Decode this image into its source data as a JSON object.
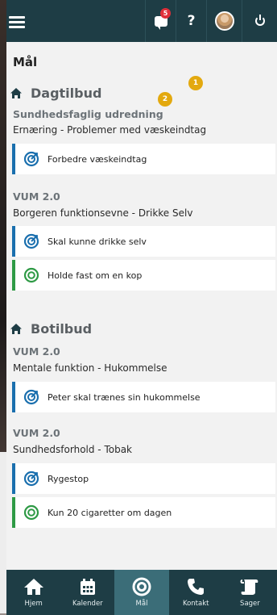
{
  "header": {
    "notification_count": "5",
    "help_label": "?"
  },
  "page": {
    "title": "Mål"
  },
  "markers": [
    "1",
    "2"
  ],
  "sections": [
    {
      "name": "Dagtilbud",
      "groups": [
        {
          "title": "Sundhedsfaglig udredning",
          "subtitle": "Ernæring - Problemer med væskeindtag",
          "goals": [
            {
              "label": "Forbedre væskeindtag",
              "type": "blue"
            }
          ]
        },
        {
          "title": "VUM 2.0",
          "subtitle": "Borgeren funktionsevne - Drikke Selv",
          "goals": [
            {
              "label": "Skal kunne drikke selv",
              "type": "blue"
            },
            {
              "label": "Holde fast om en kop",
              "type": "green"
            }
          ]
        }
      ]
    },
    {
      "name": "Botilbud",
      "groups": [
        {
          "title": "VUM 2.0",
          "subtitle": "Mentale funktion - Hukommelse",
          "goals": [
            {
              "label": "Peter skal trænes sin hukommelse",
              "type": "blue"
            }
          ]
        },
        {
          "title": "VUM 2.0",
          "subtitle": "Sundhedsforhold - Tobak",
          "goals": [
            {
              "label": "Rygestop",
              "type": "blue"
            },
            {
              "label": "Kun 20 cigaretter om dagen",
              "type": "green"
            }
          ]
        }
      ]
    }
  ],
  "bottom_nav": [
    {
      "label": "Hjem",
      "icon": "home-icon"
    },
    {
      "label": "Kalender",
      "icon": "calendar-icon"
    },
    {
      "label": "Mål",
      "icon": "target-icon",
      "active": true
    },
    {
      "label": "Kontakt",
      "icon": "phone-icon"
    },
    {
      "label": "Sager",
      "icon": "scroll-icon"
    }
  ],
  "colors": {
    "header": "#1e3d45",
    "nav_active": "#3b6d78",
    "blue_accent": "#1a6fae",
    "green_accent": "#2e9a45",
    "marker": "#e3a90f"
  }
}
